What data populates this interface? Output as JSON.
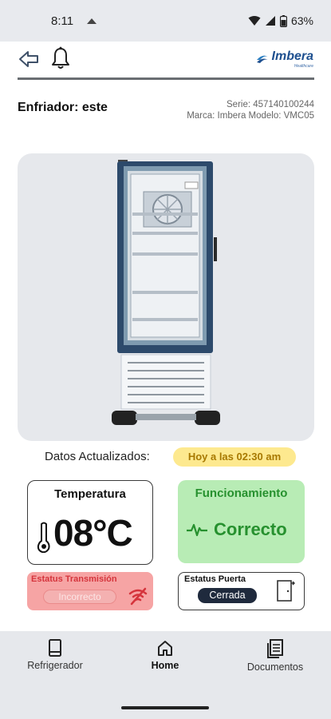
{
  "status_bar": {
    "time": "8:11",
    "battery": "63%"
  },
  "brand": {
    "name": "Imbera",
    "sub": "Healthcare"
  },
  "cooler": {
    "title": "Enfriador: este",
    "serie": "Serie: 457140100244",
    "marca_modelo": "Marca: Imbera    Modelo: VMC05"
  },
  "updated": {
    "label": "Datos Actualizados:",
    "value": "Hoy a las 02:30 am"
  },
  "temperature": {
    "title": "Temperatura",
    "value": "08°C"
  },
  "function": {
    "title": "Funcionamiento",
    "value": "Correcto"
  },
  "transmission": {
    "title": "Estatus Transmisión",
    "value": "Incorrecto"
  },
  "door": {
    "title": "Estatus Puerta",
    "value": "Cerrada"
  },
  "nav": [
    {
      "label": "Refrigerador",
      "icon": "tablet-icon"
    },
    {
      "label": "Home",
      "icon": "home-icon"
    },
    {
      "label": "Documentos",
      "icon": "documents-icon"
    }
  ],
  "colors": {
    "ok_green": "#27912f",
    "ok_bg": "#b8ecb5",
    "error_red": "#d5343c",
    "error_bg": "#f6a4a4",
    "badge_yellow": "#fde98f",
    "brand_blue": "#1d4f8f"
  }
}
